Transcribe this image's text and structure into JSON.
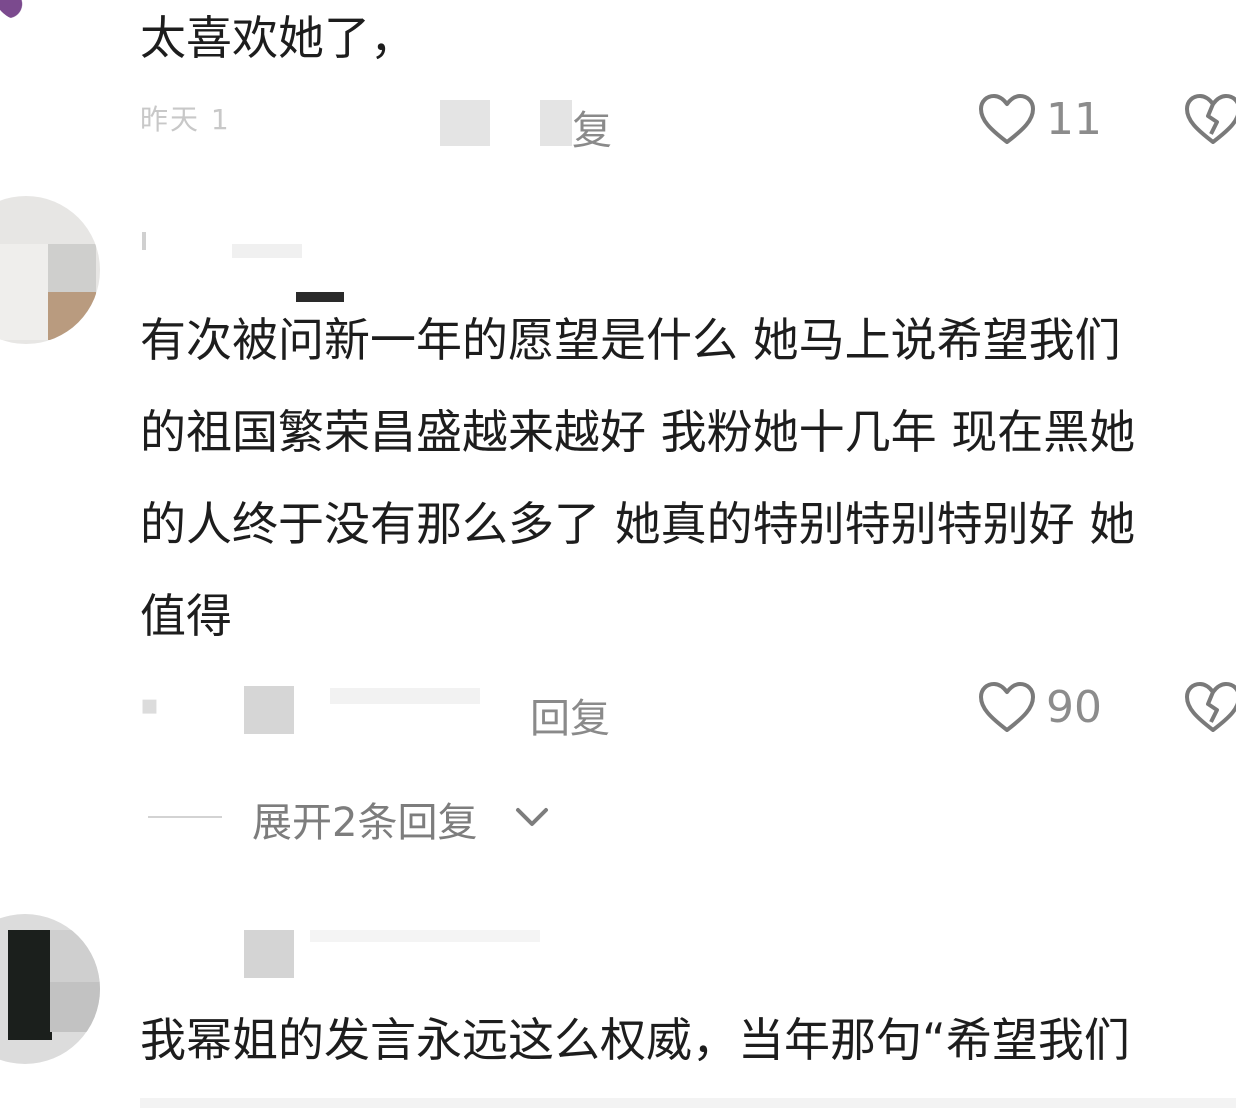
{
  "comments": [
    {
      "text_lines": [
        "太喜欢她了，"
      ],
      "reply_label": "复",
      "likes": "11"
    },
    {
      "text_lines": [
        "有次被问新一年的愿望是什么 她马上说希望我们",
        "的祖国繁荣昌盛越来越好 我粉她十几年 现在黑她",
        "的人终于没有那么多了 她真的特别特别特别好 她",
        "值得"
      ],
      "reply_label": "回复",
      "likes": "90",
      "expand_replies": "展开2条回复"
    },
    {
      "text_lines": [
        "我幂姐的发言永远这么权威，当年那句“希望我们"
      ]
    }
  ],
  "icons": {
    "like": "heart-outline-icon",
    "dislike": "broken-heart-icon",
    "expand": "chevron-down-icon"
  },
  "colors": {
    "text": "#1d1d1d",
    "meta": "#8a8a8a",
    "icon": "#7a7a7a"
  }
}
